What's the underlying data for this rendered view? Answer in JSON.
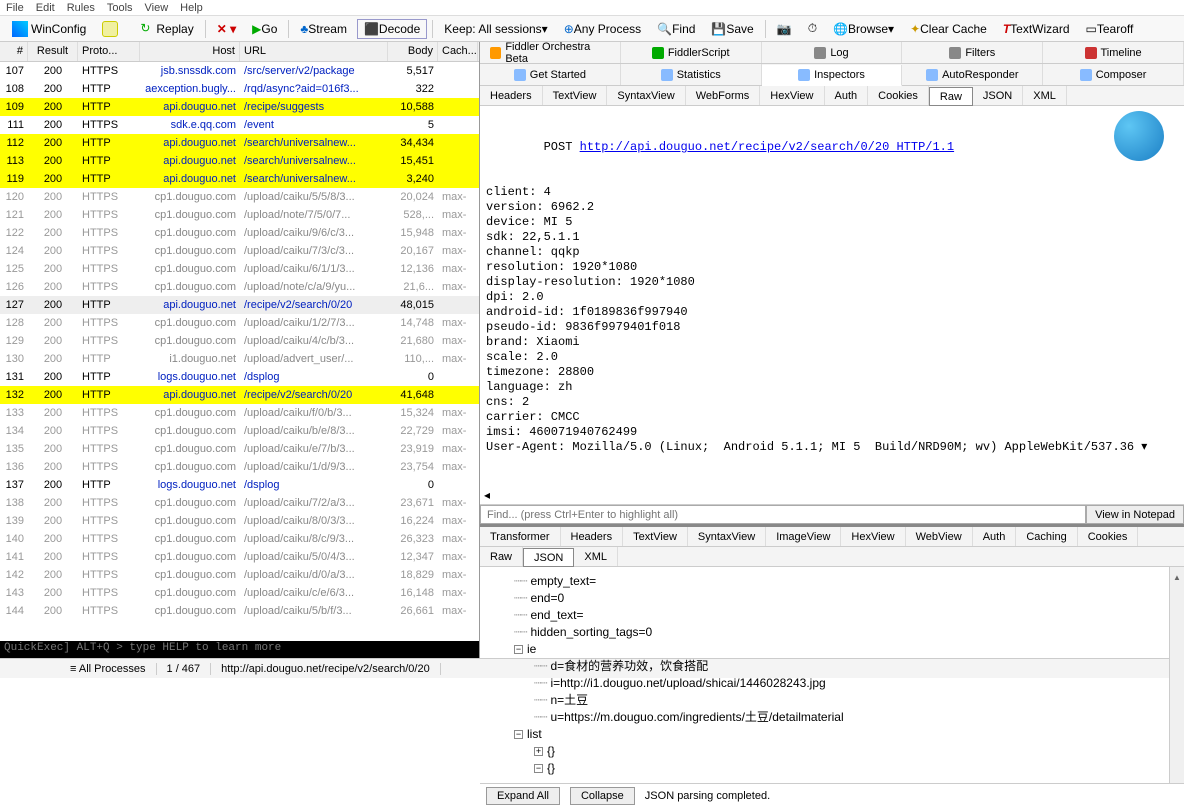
{
  "menubar": [
    "File",
    "Edit",
    "Rules",
    "Tools",
    "View",
    "Help"
  ],
  "toolbar": {
    "winconfig": "WinConfig",
    "replay": "Replay",
    "go": "Go",
    "stream": "Stream",
    "decode": "Decode",
    "keep": "Keep: All sessions",
    "anyprocess": "Any Process",
    "find": "Find",
    "save": "Save",
    "browse": "Browse",
    "clearcache": "Clear Cache",
    "textwizard": "TextWizard",
    "tearoff": "Tearoff"
  },
  "grid": {
    "headers": {
      "num": "#",
      "result": "Result",
      "proto": "Proto...",
      "host": "Host",
      "url": "URL",
      "body": "Body",
      "cache": "Cach..."
    },
    "rows": [
      {
        "n": "107",
        "r": "200",
        "p": "HTTPS",
        "h": "jsb.snssdk.com",
        "u": "/src/server/v2/package",
        "b": "5,517",
        "c": "",
        "dim": false
      },
      {
        "n": "108",
        "r": "200",
        "p": "HTTP",
        "h": "aexception.bugly...",
        "u": "/rqd/async?aid=016f3...",
        "b": "322",
        "c": "",
        "dim": false
      },
      {
        "n": "109",
        "r": "200",
        "p": "HTTP",
        "h": "api.douguo.net",
        "u": "/recipe/suggests",
        "b": "10,588",
        "c": "",
        "hl": true
      },
      {
        "n": "111",
        "r": "200",
        "p": "HTTPS",
        "h": "sdk.e.qq.com",
        "u": "/event",
        "b": "5",
        "c": "",
        "dim": false
      },
      {
        "n": "112",
        "r": "200",
        "p": "HTTP",
        "h": "api.douguo.net",
        "u": "/search/universalnew...",
        "b": "34,434",
        "c": "",
        "hl": true
      },
      {
        "n": "113",
        "r": "200",
        "p": "HTTP",
        "h": "api.douguo.net",
        "u": "/search/universalnew...",
        "b": "15,451",
        "c": "",
        "hl": true
      },
      {
        "n": "119",
        "r": "200",
        "p": "HTTP",
        "h": "api.douguo.net",
        "u": "/search/universalnew...",
        "b": "3,240",
        "c": "",
        "hl": true
      },
      {
        "n": "120",
        "r": "200",
        "p": "HTTPS",
        "h": "cp1.douguo.com",
        "u": "/upload/caiku/5/5/8/3...",
        "b": "20,024",
        "c": "max-",
        "dim": true
      },
      {
        "n": "121",
        "r": "200",
        "p": "HTTPS",
        "h": "cp1.douguo.com",
        "u": "/upload/note/7/5/0/7...",
        "b": "528,...",
        "c": "max-",
        "dim": true
      },
      {
        "n": "122",
        "r": "200",
        "p": "HTTPS",
        "h": "cp1.douguo.com",
        "u": "/upload/caiku/9/6/c/3...",
        "b": "15,948",
        "c": "max-",
        "dim": true
      },
      {
        "n": "124",
        "r": "200",
        "p": "HTTPS",
        "h": "cp1.douguo.com",
        "u": "/upload/caiku/7/3/c/3...",
        "b": "20,167",
        "c": "max-",
        "dim": true
      },
      {
        "n": "125",
        "r": "200",
        "p": "HTTPS",
        "h": "cp1.douguo.com",
        "u": "/upload/caiku/6/1/1/3...",
        "b": "12,136",
        "c": "max-",
        "dim": true
      },
      {
        "n": "126",
        "r": "200",
        "p": "HTTPS",
        "h": "cp1.douguo.com",
        "u": "/upload/note/c/a/9/yu...",
        "b": "21,6...",
        "c": "max-",
        "dim": true
      },
      {
        "n": "127",
        "r": "200",
        "p": "HTTP",
        "h": "api.douguo.net",
        "u": "/recipe/v2/search/0/20",
        "b": "48,015",
        "c": "",
        "sel": true
      },
      {
        "n": "128",
        "r": "200",
        "p": "HTTPS",
        "h": "cp1.douguo.com",
        "u": "/upload/caiku/1/2/7/3...",
        "b": "14,748",
        "c": "max-",
        "dim": true
      },
      {
        "n": "129",
        "r": "200",
        "p": "HTTPS",
        "h": "cp1.douguo.com",
        "u": "/upload/caiku/4/c/b/3...",
        "b": "21,680",
        "c": "max-",
        "dim": true
      },
      {
        "n": "130",
        "r": "200",
        "p": "HTTP",
        "h": "i1.douguo.net",
        "u": "/upload/advert_user/...",
        "b": "110,...",
        "c": "max-",
        "dim": true
      },
      {
        "n": "131",
        "r": "200",
        "p": "HTTP",
        "h": "logs.douguo.net",
        "u": "/dsplog",
        "b": "0",
        "c": "",
        "dim": false
      },
      {
        "n": "132",
        "r": "200",
        "p": "HTTP",
        "h": "api.douguo.net",
        "u": "/recipe/v2/search/0/20",
        "b": "41,648",
        "c": "",
        "hl": true
      },
      {
        "n": "133",
        "r": "200",
        "p": "HTTPS",
        "h": "cp1.douguo.com",
        "u": "/upload/caiku/f/0/b/3...",
        "b": "15,324",
        "c": "max-",
        "dim": true
      },
      {
        "n": "134",
        "r": "200",
        "p": "HTTPS",
        "h": "cp1.douguo.com",
        "u": "/upload/caiku/b/e/8/3...",
        "b": "22,729",
        "c": "max-",
        "dim": true
      },
      {
        "n": "135",
        "r": "200",
        "p": "HTTPS",
        "h": "cp1.douguo.com",
        "u": "/upload/caiku/e/7/b/3...",
        "b": "23,919",
        "c": "max-",
        "dim": true
      },
      {
        "n": "136",
        "r": "200",
        "p": "HTTPS",
        "h": "cp1.douguo.com",
        "u": "/upload/caiku/1/d/9/3...",
        "b": "23,754",
        "c": "max-",
        "dim": true
      },
      {
        "n": "137",
        "r": "200",
        "p": "HTTP",
        "h": "logs.douguo.net",
        "u": "/dsplog",
        "b": "0",
        "c": "",
        "dim": false
      },
      {
        "n": "138",
        "r": "200",
        "p": "HTTPS",
        "h": "cp1.douguo.com",
        "u": "/upload/caiku/7/2/a/3...",
        "b": "23,671",
        "c": "max-",
        "dim": true
      },
      {
        "n": "139",
        "r": "200",
        "p": "HTTPS",
        "h": "cp1.douguo.com",
        "u": "/upload/caiku/8/0/3/3...",
        "b": "16,224",
        "c": "max-",
        "dim": true
      },
      {
        "n": "140",
        "r": "200",
        "p": "HTTPS",
        "h": "cp1.douguo.com",
        "u": "/upload/caiku/8/c/9/3...",
        "b": "26,323",
        "c": "max-",
        "dim": true
      },
      {
        "n": "141",
        "r": "200",
        "p": "HTTPS",
        "h": "cp1.douguo.com",
        "u": "/upload/caiku/5/0/4/3...",
        "b": "12,347",
        "c": "max-",
        "dim": true
      },
      {
        "n": "142",
        "r": "200",
        "p": "HTTPS",
        "h": "cp1.douguo.com",
        "u": "/upload/caiku/d/0/a/3...",
        "b": "18,829",
        "c": "max-",
        "dim": true
      },
      {
        "n": "143",
        "r": "200",
        "p": "HTTPS",
        "h": "cp1.douguo.com",
        "u": "/upload/caiku/c/e/6/3...",
        "b": "16,148",
        "c": "max-",
        "dim": true
      },
      {
        "n": "144",
        "r": "200",
        "p": "HTTPS",
        "h": "cp1.douguo.com",
        "u": "/upload/caiku/5/b/f/3...",
        "b": "26,661",
        "c": "max-",
        "dim": true
      }
    ]
  },
  "upperTabs1": [
    {
      "label": "Fiddler Orchestra Beta",
      "icon": "#f90"
    },
    {
      "label": "FiddlerScript",
      "icon": "#0a0"
    },
    {
      "label": "Log",
      "icon": "#888"
    },
    {
      "label": "Filters",
      "icon": "#888"
    },
    {
      "label": "Timeline",
      "icon": "#c33"
    }
  ],
  "upperTabs2": [
    {
      "label": "Get Started"
    },
    {
      "label": "Statistics"
    },
    {
      "label": "Inspectors",
      "active": true
    },
    {
      "label": "AutoResponder"
    },
    {
      "label": "Composer"
    }
  ],
  "reqTabs": [
    "Headers",
    "TextView",
    "SyntaxView",
    "WebForms",
    "HexView",
    "Auth",
    "Cookies",
    "Raw",
    "JSON",
    "XML"
  ],
  "reqActive": "Raw",
  "raw": {
    "method": "POST ",
    "url": "http://api.douguo.net/recipe/v2/search/0/20 HTTP/1.1",
    "lines": [
      "client: 4",
      "version: 6962.2",
      "device: MI 5",
      "sdk: 22,5.1.1",
      "channel: qqkp",
      "resolution: 1920*1080",
      "display-resolution: 1920*1080",
      "dpi: 2.0",
      "android-id: 1f0189836f997940",
      "pseudo-id: 9836f9979401f018",
      "brand: Xiaomi",
      "scale: 2.0",
      "timezone: 28800",
      "language: zh",
      "cns: 2",
      "carrier: CMCC",
      "imsi: 460071940762499",
      "User-Agent: Mozilla/5.0 (Linux;  Android 5.1.1; MI 5  Build/NRD90M; wv) AppleWebKit/537.36 ▾"
    ]
  },
  "find": {
    "placeholder": "Find... (press Ctrl+Enter to highlight all)",
    "btn": "View in Notepad"
  },
  "respTabs": [
    "Transformer",
    "Headers",
    "TextView",
    "SyntaxView",
    "ImageView",
    "HexView",
    "WebView",
    "Auth",
    "Caching",
    "Cookies"
  ],
  "respTabs2": [
    "Raw",
    "JSON",
    "XML"
  ],
  "respActive": "JSON",
  "json": [
    {
      "t": "empty_text=",
      "i": 1
    },
    {
      "t": "end=0",
      "i": 1
    },
    {
      "t": "end_text=",
      "i": 1
    },
    {
      "t": "hidden_sorting_tags=0",
      "i": 1
    },
    {
      "t": "ie",
      "i": 1,
      "box": "-"
    },
    {
      "t": "d=食材的营养功效，饮食搭配",
      "i": 2
    },
    {
      "t": "i=http://i1.douguo.net/upload/shicai/1446028243.jpg",
      "i": 2
    },
    {
      "t": "n=土豆",
      "i": 2
    },
    {
      "t": "u=https://m.douguo.com/ingredients/土豆/detailmaterial",
      "i": 2
    },
    {
      "t": "list",
      "i": 1,
      "box": "-"
    },
    {
      "t": "{}",
      "i": 2,
      "box": "+"
    },
    {
      "t": "{}",
      "i": 2,
      "box": "-"
    }
  ],
  "bottomBtns": {
    "expand": "Expand All",
    "collapse": "Collapse",
    "msg": "JSON parsing completed."
  },
  "quickexec": "QuickExec] ALT+Q > type HELP to learn more",
  "status": {
    "procs": "All Processes",
    "count": "1 / 467",
    "url": "http://api.douguo.net/recipe/v2/search/0/20"
  }
}
